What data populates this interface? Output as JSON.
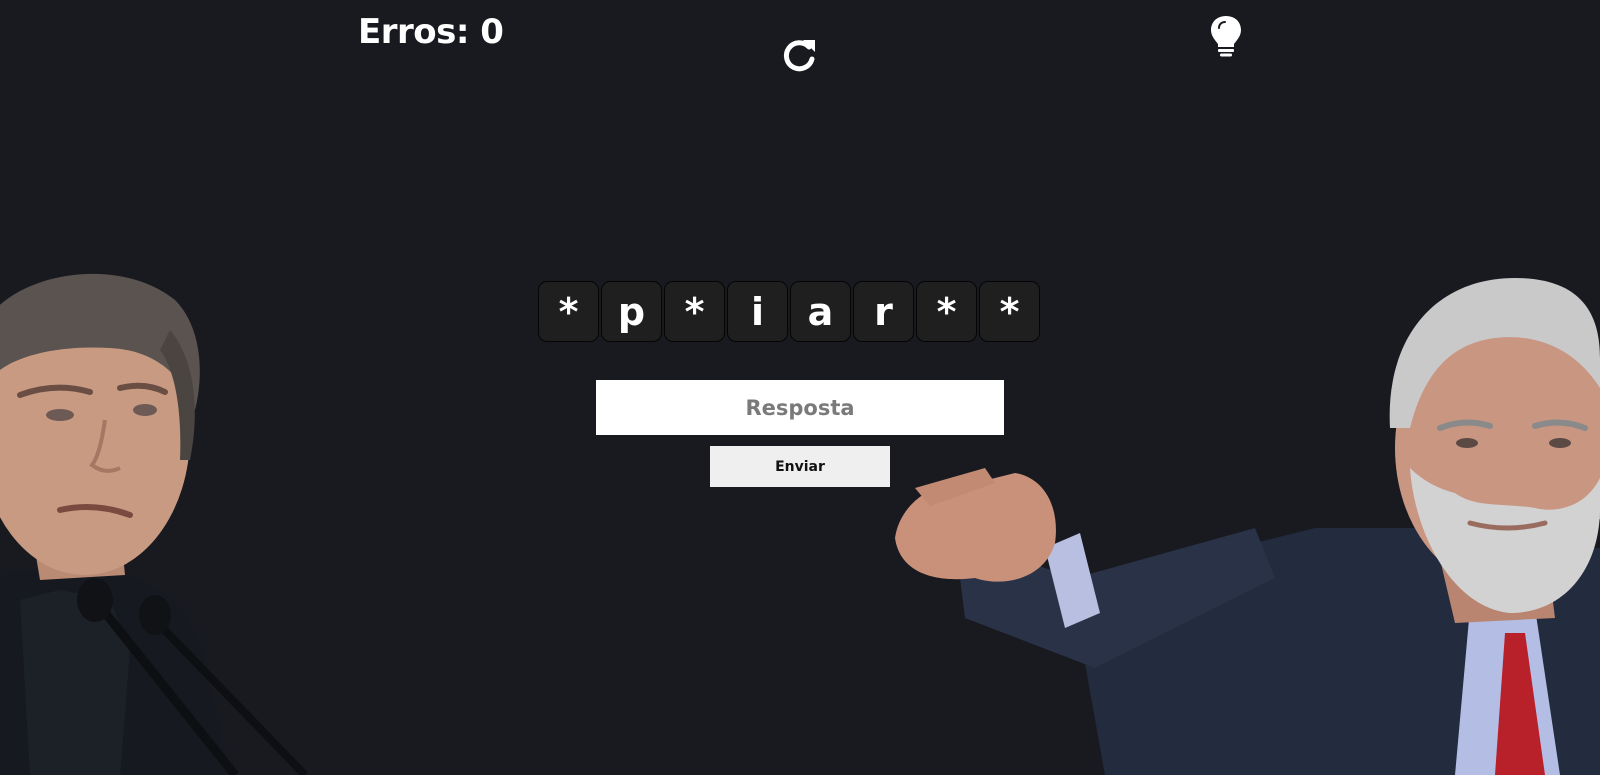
{
  "header": {
    "errors_text": "Erros: 0",
    "reload_icon": "reload-icon",
    "hint_icon": "lightbulb-icon"
  },
  "word": {
    "letters": [
      "*",
      "p",
      "*",
      "i",
      "a",
      "r",
      "*",
      "*"
    ]
  },
  "answer": {
    "placeholder": "Resposta",
    "value": ""
  },
  "send_button": {
    "label": "Enviar"
  },
  "colors": {
    "background": "#181a20",
    "tile_background": "#1f1f1f",
    "text": "#ffffff",
    "input_background": "#ffffff",
    "button_background": "#efefef"
  }
}
